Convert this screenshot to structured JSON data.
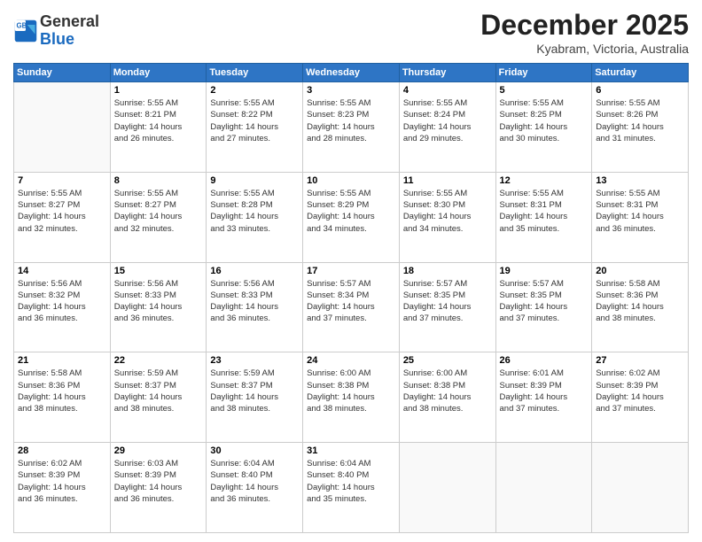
{
  "logo": {
    "line1": "General",
    "line2": "Blue"
  },
  "header": {
    "month": "December 2025",
    "location": "Kyabram, Victoria, Australia"
  },
  "weekdays": [
    "Sunday",
    "Monday",
    "Tuesday",
    "Wednesday",
    "Thursday",
    "Friday",
    "Saturday"
  ],
  "weeks": [
    [
      {
        "day": "",
        "info": ""
      },
      {
        "day": "1",
        "info": "Sunrise: 5:55 AM\nSunset: 8:21 PM\nDaylight: 14 hours\nand 26 minutes."
      },
      {
        "day": "2",
        "info": "Sunrise: 5:55 AM\nSunset: 8:22 PM\nDaylight: 14 hours\nand 27 minutes."
      },
      {
        "day": "3",
        "info": "Sunrise: 5:55 AM\nSunset: 8:23 PM\nDaylight: 14 hours\nand 28 minutes."
      },
      {
        "day": "4",
        "info": "Sunrise: 5:55 AM\nSunset: 8:24 PM\nDaylight: 14 hours\nand 29 minutes."
      },
      {
        "day": "5",
        "info": "Sunrise: 5:55 AM\nSunset: 8:25 PM\nDaylight: 14 hours\nand 30 minutes."
      },
      {
        "day": "6",
        "info": "Sunrise: 5:55 AM\nSunset: 8:26 PM\nDaylight: 14 hours\nand 31 minutes."
      }
    ],
    [
      {
        "day": "7",
        "info": "Sunrise: 5:55 AM\nSunset: 8:27 PM\nDaylight: 14 hours\nand 32 minutes."
      },
      {
        "day": "8",
        "info": "Sunrise: 5:55 AM\nSunset: 8:27 PM\nDaylight: 14 hours\nand 32 minutes."
      },
      {
        "day": "9",
        "info": "Sunrise: 5:55 AM\nSunset: 8:28 PM\nDaylight: 14 hours\nand 33 minutes."
      },
      {
        "day": "10",
        "info": "Sunrise: 5:55 AM\nSunset: 8:29 PM\nDaylight: 14 hours\nand 34 minutes."
      },
      {
        "day": "11",
        "info": "Sunrise: 5:55 AM\nSunset: 8:30 PM\nDaylight: 14 hours\nand 34 minutes."
      },
      {
        "day": "12",
        "info": "Sunrise: 5:55 AM\nSunset: 8:31 PM\nDaylight: 14 hours\nand 35 minutes."
      },
      {
        "day": "13",
        "info": "Sunrise: 5:55 AM\nSunset: 8:31 PM\nDaylight: 14 hours\nand 36 minutes."
      }
    ],
    [
      {
        "day": "14",
        "info": "Sunrise: 5:56 AM\nSunset: 8:32 PM\nDaylight: 14 hours\nand 36 minutes."
      },
      {
        "day": "15",
        "info": "Sunrise: 5:56 AM\nSunset: 8:33 PM\nDaylight: 14 hours\nand 36 minutes."
      },
      {
        "day": "16",
        "info": "Sunrise: 5:56 AM\nSunset: 8:33 PM\nDaylight: 14 hours\nand 36 minutes."
      },
      {
        "day": "17",
        "info": "Sunrise: 5:57 AM\nSunset: 8:34 PM\nDaylight: 14 hours\nand 37 minutes."
      },
      {
        "day": "18",
        "info": "Sunrise: 5:57 AM\nSunset: 8:35 PM\nDaylight: 14 hours\nand 37 minutes."
      },
      {
        "day": "19",
        "info": "Sunrise: 5:57 AM\nSunset: 8:35 PM\nDaylight: 14 hours\nand 37 minutes."
      },
      {
        "day": "20",
        "info": "Sunrise: 5:58 AM\nSunset: 8:36 PM\nDaylight: 14 hours\nand 38 minutes."
      }
    ],
    [
      {
        "day": "21",
        "info": "Sunrise: 5:58 AM\nSunset: 8:36 PM\nDaylight: 14 hours\nand 38 minutes."
      },
      {
        "day": "22",
        "info": "Sunrise: 5:59 AM\nSunset: 8:37 PM\nDaylight: 14 hours\nand 38 minutes."
      },
      {
        "day": "23",
        "info": "Sunrise: 5:59 AM\nSunset: 8:37 PM\nDaylight: 14 hours\nand 38 minutes."
      },
      {
        "day": "24",
        "info": "Sunrise: 6:00 AM\nSunset: 8:38 PM\nDaylight: 14 hours\nand 38 minutes."
      },
      {
        "day": "25",
        "info": "Sunrise: 6:00 AM\nSunset: 8:38 PM\nDaylight: 14 hours\nand 38 minutes."
      },
      {
        "day": "26",
        "info": "Sunrise: 6:01 AM\nSunset: 8:39 PM\nDaylight: 14 hours\nand 37 minutes."
      },
      {
        "day": "27",
        "info": "Sunrise: 6:02 AM\nSunset: 8:39 PM\nDaylight: 14 hours\nand 37 minutes."
      }
    ],
    [
      {
        "day": "28",
        "info": "Sunrise: 6:02 AM\nSunset: 8:39 PM\nDaylight: 14 hours\nand 36 minutes."
      },
      {
        "day": "29",
        "info": "Sunrise: 6:03 AM\nSunset: 8:39 PM\nDaylight: 14 hours\nand 36 minutes."
      },
      {
        "day": "30",
        "info": "Sunrise: 6:04 AM\nSunset: 8:40 PM\nDaylight: 14 hours\nand 36 minutes."
      },
      {
        "day": "31",
        "info": "Sunrise: 6:04 AM\nSunset: 8:40 PM\nDaylight: 14 hours\nand 35 minutes."
      },
      {
        "day": "",
        "info": ""
      },
      {
        "day": "",
        "info": ""
      },
      {
        "day": "",
        "info": ""
      }
    ]
  ]
}
